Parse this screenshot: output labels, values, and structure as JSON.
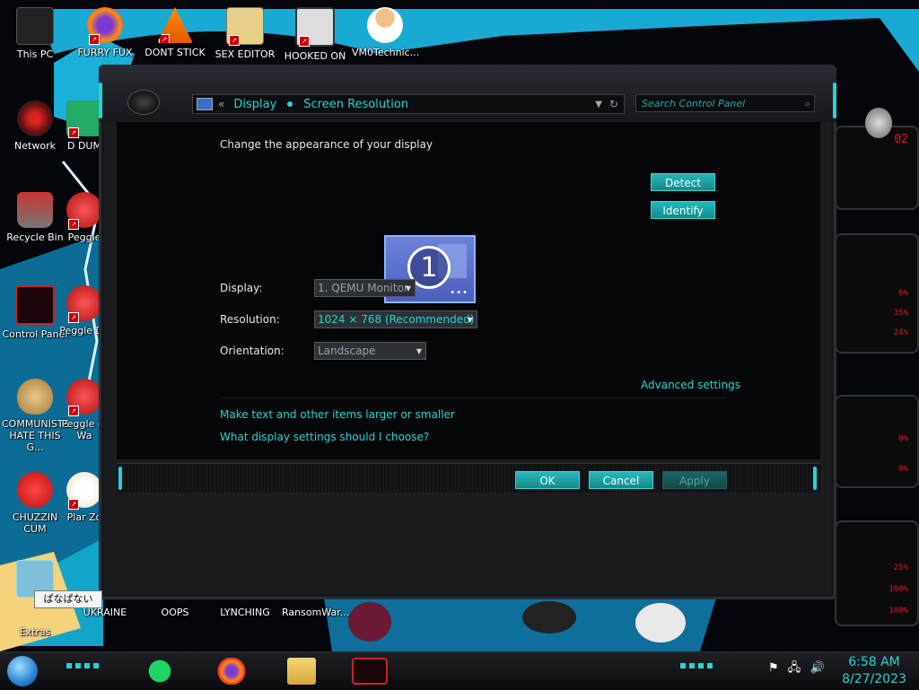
{
  "desktop": {
    "icons": [
      {
        "label": "This PC",
        "icon": "pc-icon"
      },
      {
        "label": "FURRY FUX",
        "icon": "firefox-icon"
      },
      {
        "label": "DONT STICK",
        "icon": "vlc-icon"
      },
      {
        "label": "SEX EDITOR",
        "icon": "hxd-icon"
      },
      {
        "label": "HOOKED ON",
        "icon": "maze-icon"
      },
      {
        "label": "VM0Technic...",
        "icon": "doctor-icon"
      },
      {
        "label": "Network",
        "icon": "network-icon"
      },
      {
        "label": "D DUM",
        "icon": "app-icon"
      },
      {
        "label": "Recycle Bin",
        "icon": "recycle-bin-icon"
      },
      {
        "label": "Peggle",
        "icon": "peggle-icon"
      },
      {
        "label": "Control Panel",
        "icon": "control-panel-icon"
      },
      {
        "label": "Peggle De",
        "icon": "peggle-icon"
      },
      {
        "label": "COMMUNISTS HATE THIS G...",
        "icon": "money-bag-icon"
      },
      {
        "label": "Peggle of Wa",
        "icon": "peggle-icon"
      },
      {
        "label": "CHUZZIN CUM",
        "icon": "chuzzle-icon"
      },
      {
        "label": "Plar Zo",
        "icon": "plants-icon"
      },
      {
        "label": "Extras",
        "icon": "extras-icon"
      },
      {
        "label": "UKRAINE",
        "icon": "folder-icon"
      },
      {
        "label": "OOPS",
        "icon": "folder-icon"
      },
      {
        "label": "LYNCHING",
        "icon": "folder-icon"
      },
      {
        "label": "RansomWar...",
        "icon": "folder-icon"
      }
    ],
    "tooltip": "ぱなぱない"
  },
  "hud": {
    "readouts": [
      "02",
      "6%",
      "35%",
      "24%",
      "0%",
      "0%",
      "25%",
      "100%",
      "100%"
    ]
  },
  "window": {
    "breadcrumb": {
      "back": "«",
      "items": [
        "Display",
        "Screen Resolution"
      ]
    },
    "search_placeholder": "Search Control Panel",
    "heading": "Change the appearance of your display",
    "detect_label": "Detect",
    "identify_label": "Identify",
    "monitor_number": "1",
    "fields": {
      "display_label": "Display:",
      "display_value": "1. QEMU Monitor",
      "resolution_label": "Resolution:",
      "resolution_value": "1024 × 768 (Recommended)",
      "orientation_label": "Orientation:",
      "orientation_value": "Landscape"
    },
    "advanced_link": "Advanced settings",
    "link_text_size": "Make text and other items larger or smaller",
    "link_help": "What display settings should I choose?",
    "ok_label": "OK",
    "cancel_label": "Cancel",
    "apply_label": "Apply"
  },
  "taskbar": {
    "apps": [
      "spotify-icon",
      "firefox-icon",
      "file-explorer-icon",
      "control-panel-icon"
    ],
    "time": "6:58 AM",
    "date": "8/27/2023"
  },
  "colors": {
    "accent": "#2ad3d3",
    "hud_red": "#e11111",
    "wallpaper_cyan": "#1ab0d8"
  }
}
